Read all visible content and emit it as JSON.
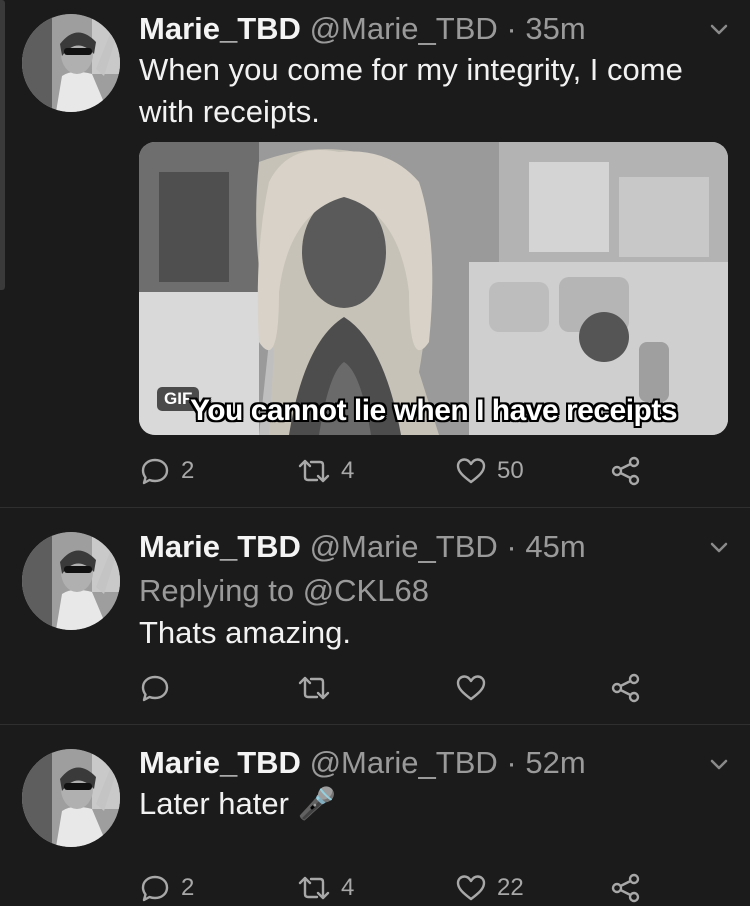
{
  "tweets": [
    {
      "name": "Marie_TBD",
      "handle": "@Marie_TBD",
      "separator": "·",
      "time": "35m",
      "text": "When you come for my integrity, I come with receipts.",
      "media": {
        "badge": "GIF",
        "caption": "You cannot lie when I have receipts"
      },
      "stats": {
        "replies": "2",
        "retweets": "4",
        "likes": "50"
      }
    },
    {
      "name": "Marie_TBD",
      "handle": "@Marie_TBD",
      "separator": "·",
      "time": "45m",
      "replying_to": "Replying to @CKL68",
      "text": "Thats amazing.",
      "stats": {
        "replies": "",
        "retweets": "",
        "likes": ""
      }
    },
    {
      "name": "Marie_TBD",
      "handle": "@Marie_TBD",
      "separator": "·",
      "time": "52m",
      "text": "Later hater 🎤",
      "stats": {
        "replies": "2",
        "retweets": "4",
        "likes": "22"
      }
    }
  ],
  "icons": {
    "reply": "reply-icon",
    "retweet": "retweet-icon",
    "like": "heart-icon",
    "share": "share-icon",
    "menu": "chevron-down-icon"
  },
  "colors": {
    "background": "#1b1b1b",
    "text": "#f0f0f0",
    "muted": "#9a9a9a"
  }
}
